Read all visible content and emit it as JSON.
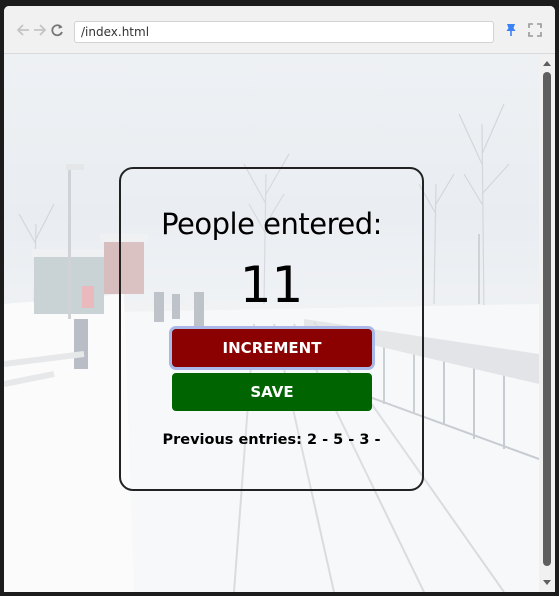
{
  "browser": {
    "address": "/index.html",
    "icons": [
      "back-arrow-icon",
      "forward-arrow-icon",
      "reload-icon",
      "pin-icon",
      "fullscreen-icon"
    ]
  },
  "card": {
    "title": "People entered:",
    "count": "11",
    "increment_label": "INCREMENT",
    "save_label": "SAVE",
    "previous_entries": "Previous entries: 2 - 5 - 3 -"
  },
  "colors": {
    "increment_button": "#8b0000",
    "save_button": "#006400",
    "focus_ring": "#a9b8e8",
    "pin_icon": "#3b82f6"
  }
}
